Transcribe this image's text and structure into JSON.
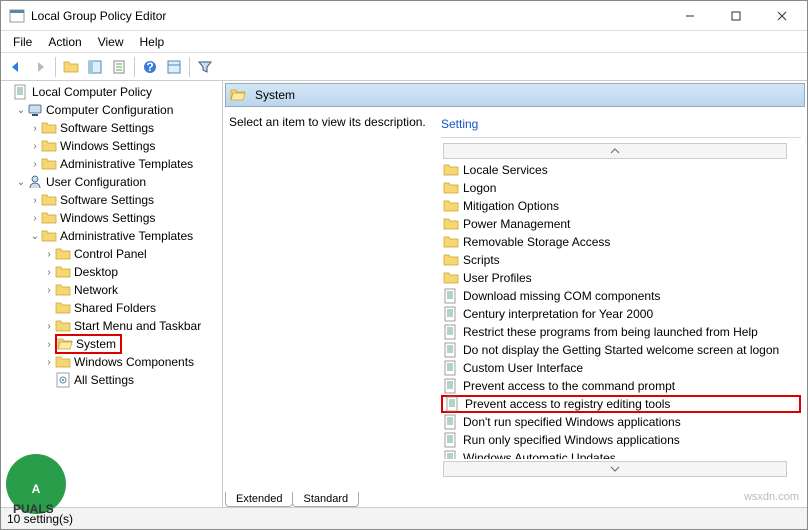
{
  "window": {
    "title": "Local Group Policy Editor"
  },
  "menubar": {
    "file": "File",
    "action": "Action",
    "view": "View",
    "help": "Help"
  },
  "tree": {
    "root": "Local Computer Policy",
    "cc": "Computer Configuration",
    "cc_sw": "Software Settings",
    "cc_win": "Windows Settings",
    "cc_at": "Administrative Templates",
    "uc": "User Configuration",
    "uc_sw": "Software Settings",
    "uc_win": "Windows Settings",
    "uc_at": "Administrative Templates",
    "cp": "Control Panel",
    "desktop": "Desktop",
    "network": "Network",
    "shared": "Shared Folders",
    "startmenu": "Start Menu and Taskbar",
    "system": "System",
    "wincomp": "Windows Components",
    "allset": "All Settings"
  },
  "pane": {
    "header": "System",
    "desc": "Select an item to view its description.",
    "setting_header": "Setting"
  },
  "settings": {
    "locale": "Locale Services",
    "logon": "Logon",
    "mitigation": "Mitigation Options",
    "power": "Power Management",
    "removable": "Removable Storage Access",
    "scripts": "Scripts",
    "profiles": "User Profiles",
    "com": "Download missing COM components",
    "century": "Century interpretation for Year 2000",
    "restrict": "Restrict these programs from being launched from Help",
    "getstarted": "Do not display the Getting Started welcome screen at logon",
    "customui": "Custom User Interface",
    "cmd": "Prevent access to the command prompt",
    "regedit": "Prevent access to registry editing tools",
    "dontrun": "Don't run specified Windows applications",
    "runonly": "Run only specified Windows applications",
    "updates": "Windows Automatic Updates"
  },
  "tabs": {
    "extended": "Extended",
    "standard": "Standard"
  },
  "status": {
    "text": "10 setting(s)"
  },
  "watermark": "wsxdn.com",
  "chart_data": null
}
